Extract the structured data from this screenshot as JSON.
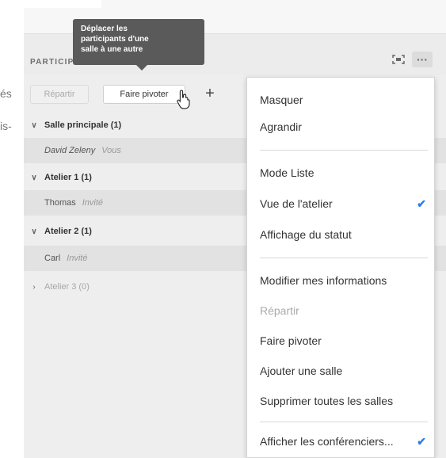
{
  "left_fragments": {
    "line1": "és",
    "line2": "is-"
  },
  "panel": {
    "title": "PARTICIPA",
    "toolbar": {
      "distribute_label": "Répartir",
      "rotate_label": "Faire pivoter",
      "add_label": "+"
    },
    "more_icon_glyph": "···",
    "rooms": [
      {
        "name": "Salle principale (1)",
        "expanded": true,
        "members": [
          {
            "name": "David Zeleny",
            "role": "Vous"
          }
        ]
      },
      {
        "name": "Atelier 1 (1)",
        "expanded": true,
        "members": [
          {
            "name": "Thomas",
            "role": "Invité"
          }
        ]
      },
      {
        "name": "Atelier 2 (1)",
        "expanded": true,
        "members": [
          {
            "name": "Carl",
            "role": "Invité"
          }
        ]
      },
      {
        "name": "Atelier 3 (0)",
        "expanded": false,
        "members": []
      }
    ]
  },
  "tooltip": {
    "line1": "Déplacer les",
    "line2": "participants d'une",
    "line3": "salle à une autre"
  },
  "menu": {
    "items": [
      {
        "label": "Masquer"
      },
      {
        "label": "Agrandir"
      },
      {
        "label": "Mode Liste"
      },
      {
        "label": "Vue de l'atelier",
        "checked": true
      },
      {
        "label": "Affichage du statut"
      },
      {
        "label": "Modifier mes informations"
      },
      {
        "label": "Répartir",
        "disabled": true
      },
      {
        "label": "Faire pivoter"
      },
      {
        "label": "Ajouter une salle"
      },
      {
        "label": "Supprimer toutes les salles"
      },
      {
        "label": "Afficher les conférenciers...",
        "checked": true
      }
    ]
  },
  "colors": {
    "accent": "#2680eb",
    "tooltip_bg": "#5a5a5a"
  }
}
